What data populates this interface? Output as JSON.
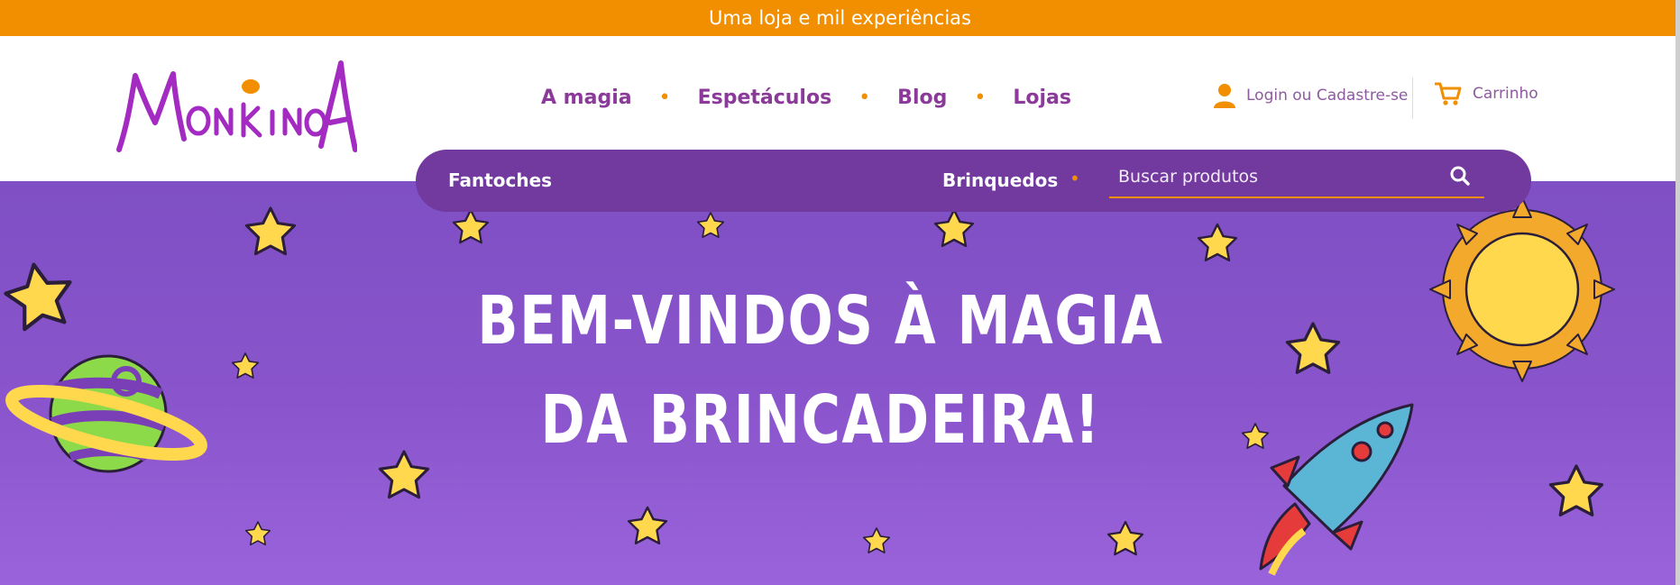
{
  "announcement": {
    "text": "Uma loja e mil experiências"
  },
  "header": {
    "logo_text": "MonkinoA",
    "nav": [
      {
        "label": "A magia"
      },
      {
        "label": "Espetáculos"
      },
      {
        "label": "Blog"
      },
      {
        "label": "Lojas"
      }
    ],
    "account_label": "Login ou Cadastre-se",
    "cart_label": "Carrinho"
  },
  "categories": {
    "items": [
      {
        "label": "Fantoches"
      },
      {
        "label": "Brinquedos"
      }
    ],
    "search_placeholder": "Buscar produtos"
  },
  "hero": {
    "line1": "BEM-VINDOS À MAGIA",
    "line2": "DA BRINCADEIRA!"
  },
  "colors": {
    "accent": "#f18f01",
    "brand_purple": "#8b3a99",
    "category_bar": "#72399f",
    "hero_bg": "#8a55cc",
    "star": "#ffd84d"
  },
  "icons": {
    "account": "user-icon",
    "cart": "cart-icon",
    "search": "search-icon"
  }
}
